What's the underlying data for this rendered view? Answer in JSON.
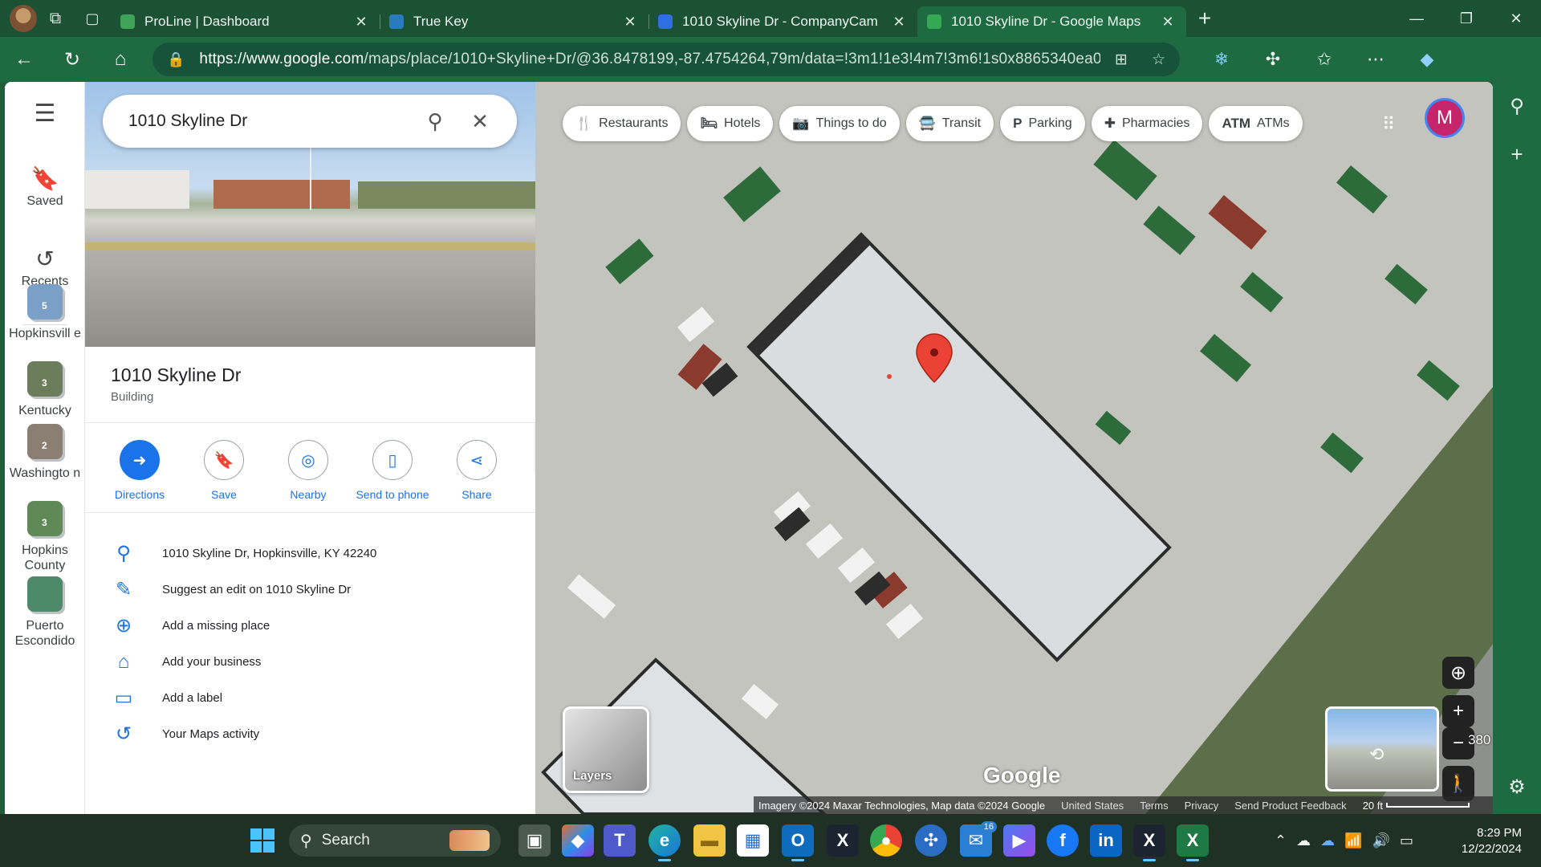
{
  "browser": {
    "tabs": [
      {
        "title": "ProLine | Dashboard",
        "favicon_color": "#3fa45a",
        "active": false
      },
      {
        "title": "True Key",
        "favicon_color": "#2a7bbd",
        "active": false
      },
      {
        "title": "1010 Skyline Dr - CompanyCam",
        "favicon_color": "#2f6fe0",
        "active": false
      },
      {
        "title": "1010 Skyline Dr - Google Maps",
        "favicon_color": "#34a853",
        "active": true
      }
    ],
    "url_host": "https://www.google.com",
    "url_path": "/maps/place/1010+Skyline+Dr/@36.8478199,-87.4754264,79m/data=!3m1!1e3!4m7!3m6!1s0x8865340ea0d98bc3:0x..."
  },
  "rail": {
    "saved_label": "Saved",
    "recents_label": "Recents",
    "recent_places": [
      {
        "label": "Hopkinsvill e",
        "count": "5",
        "thumb_color": "#7aa0c8"
      },
      {
        "label": "Kentucky",
        "count": "3",
        "thumb_color": "#6b7d5b"
      },
      {
        "label": "Washingto n",
        "count": "2",
        "thumb_color": "#8a7f72"
      },
      {
        "label": "Hopkins County",
        "count": "3",
        "thumb_color": "#5f8a58"
      },
      {
        "label": "Puerto Escondido",
        "count": "",
        "thumb_color": "#4e8a6a"
      }
    ]
  },
  "search": {
    "value": "1010 Skyline Dr"
  },
  "place": {
    "title": "1010 Skyline Dr",
    "type": "Building",
    "actions": [
      {
        "label": "Directions",
        "icon": "directions-icon",
        "glyph": "➜"
      },
      {
        "label": "Save",
        "icon": "bookmark-icon",
        "glyph": "🔖"
      },
      {
        "label": "Nearby",
        "icon": "nearby-icon",
        "glyph": "◎"
      },
      {
        "label": "Send to phone",
        "icon": "send-to-phone-icon",
        "glyph": "▯"
      },
      {
        "label": "Share",
        "icon": "share-icon",
        "glyph": "⋖"
      }
    ],
    "info": [
      {
        "text": "1010 Skyline Dr, Hopkinsville, KY 42240",
        "icon": "location-pin-icon",
        "glyph": "⚲"
      },
      {
        "text": "Suggest an edit on 1010 Skyline Dr",
        "icon": "pencil-icon",
        "glyph": "✎"
      },
      {
        "text": "Add a missing place",
        "icon": "add-place-icon",
        "glyph": "⊕"
      },
      {
        "text": "Add your business",
        "icon": "add-business-icon",
        "glyph": "⌂"
      },
      {
        "text": "Add a label",
        "icon": "label-icon",
        "glyph": "▭"
      },
      {
        "text": "Your Maps activity",
        "icon": "history-icon",
        "glyph": "↺"
      }
    ]
  },
  "map": {
    "categories": [
      {
        "label": "Restaurants",
        "icon": "fork-knife-icon",
        "glyph": "🍴"
      },
      {
        "label": "Hotels",
        "icon": "bed-icon",
        "glyph": "🛏"
      },
      {
        "label": "Things to do",
        "icon": "camera-icon",
        "glyph": "📷"
      },
      {
        "label": "Transit",
        "icon": "bus-icon",
        "glyph": "🚍"
      },
      {
        "label": "Parking",
        "icon": "parking-icon",
        "glyph": "P"
      },
      {
        "label": "Pharmacies",
        "icon": "pharmacy-icon",
        "glyph": "✚"
      },
      {
        "label": "ATMs",
        "icon": "atm-icon",
        "glyph": "ATM"
      }
    ],
    "account_initial": "M",
    "layers_label": "Layers",
    "zoom_partial": "380",
    "logo": "Google",
    "attribution": "Imagery ©2024 Maxar Technologies, Map data ©2024 Google",
    "links": [
      "United States",
      "Terms",
      "Privacy",
      "Send Product Feedback"
    ],
    "scale": "20 ft"
  },
  "taskbar": {
    "search_placeholder": "Search",
    "outlook_badge": "16",
    "time": "8:29 PM",
    "date": "12/22/2024"
  },
  "colors": {
    "accent": "#1a73e8",
    "pin": "#ea4335",
    "edge_chrome": "#1e6b42"
  }
}
